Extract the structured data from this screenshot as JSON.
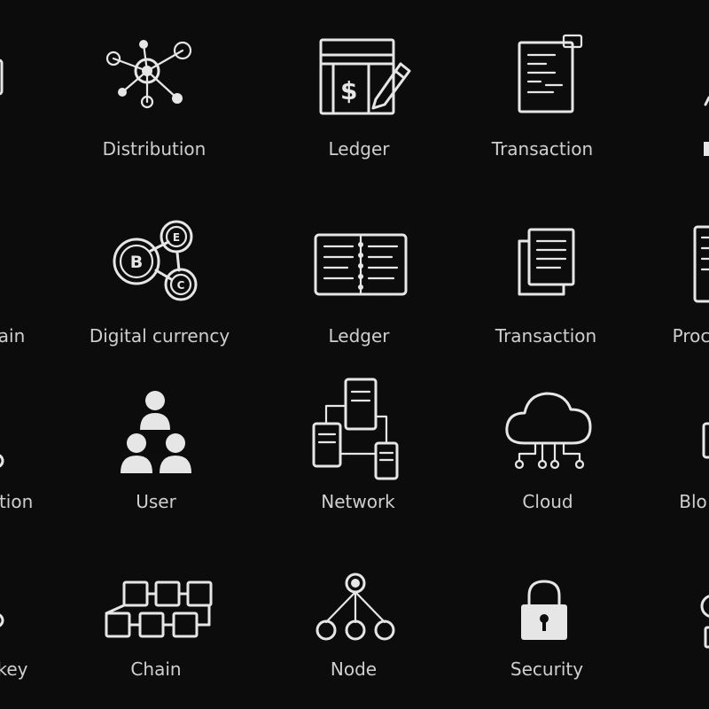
{
  "icons": [
    {
      "label": "Distribution",
      "icon": "distribution-icon"
    },
    {
      "label": "Ledger",
      "icon": "ledger-dollar-icon"
    },
    {
      "label": "Transaction",
      "icon": "transaction-document-icon"
    },
    {
      "label": "ain",
      "icon": "blockchain-icon"
    },
    {
      "label": "Digital currency",
      "icon": "digital-currency-icon"
    },
    {
      "label": "Ledger",
      "icon": "ledger-book-icon"
    },
    {
      "label": "Transaction",
      "icon": "transaction-copies-icon"
    },
    {
      "label": "Proc",
      "icon": "process-icon"
    },
    {
      "label": "ation",
      "icon": "verification-icon"
    },
    {
      "label": "User",
      "icon": "user-group-icon"
    },
    {
      "label": "Network",
      "icon": "network-servers-icon"
    },
    {
      "label": "Cloud",
      "icon": "cloud-network-icon"
    },
    {
      "label": "Blo",
      "icon": "block-icon"
    },
    {
      "label": "key",
      "icon": "key-icon"
    },
    {
      "label": "Chain",
      "icon": "chain-blocks-icon"
    },
    {
      "label": "Node",
      "icon": "node-tree-icon"
    },
    {
      "label": "Security",
      "icon": "padlock-icon"
    }
  ],
  "currency_letters": {
    "b": "B",
    "e": "E",
    "c": "C"
  },
  "dollar_symbol": "$",
  "colors": {
    "background": "#0c0c0c",
    "icon": "#e6e6e6",
    "label": "#cfcfcf"
  }
}
